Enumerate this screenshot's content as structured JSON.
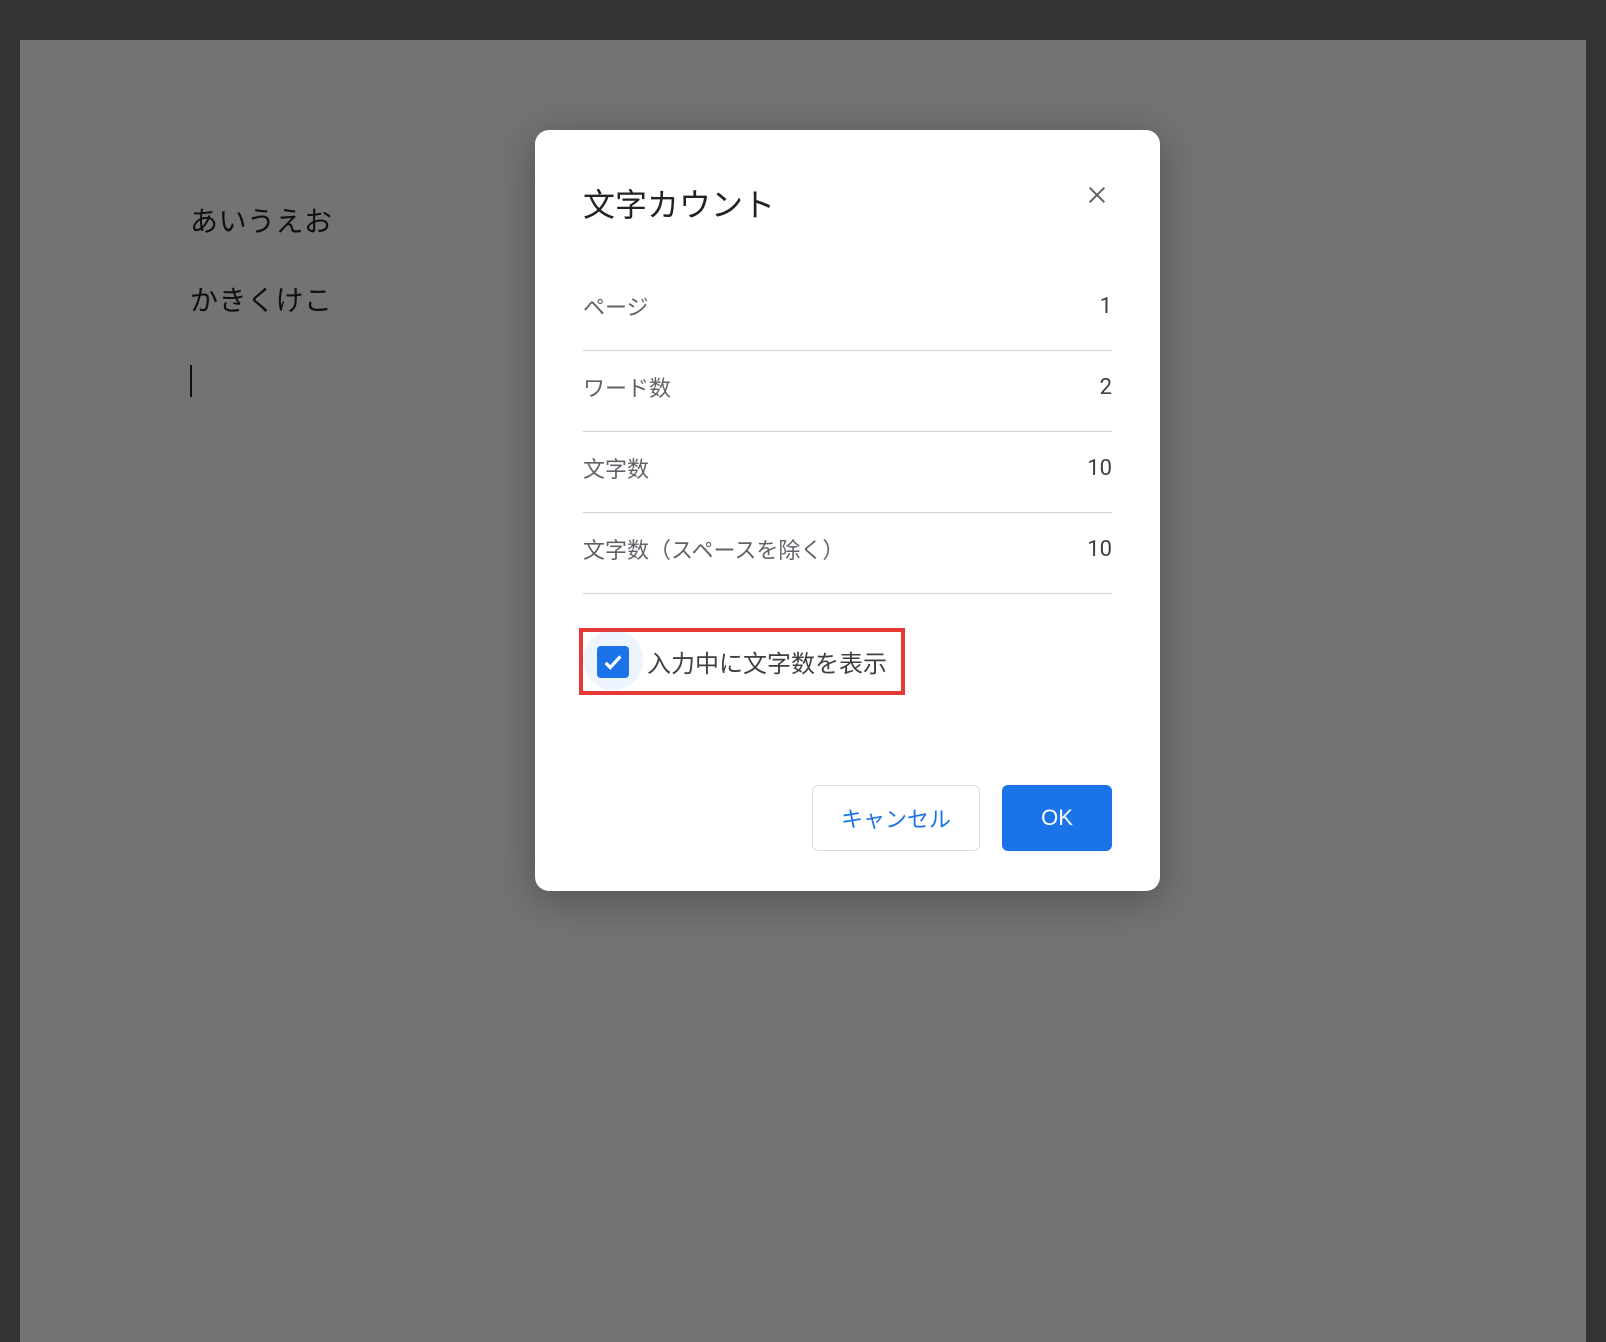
{
  "document": {
    "line1": "あいうえお",
    "line2": "かきくけこ"
  },
  "dialog": {
    "title": "文字カウント",
    "stats": [
      {
        "label": "ページ",
        "value": "1"
      },
      {
        "label": "ワード数",
        "value": "2"
      },
      {
        "label": "文字数",
        "value": "10"
      },
      {
        "label": "文字数（スペースを除く）",
        "value": "10"
      }
    ],
    "checkbox": {
      "label": "入力中に文字数を表示",
      "checked": true
    },
    "actions": {
      "cancel": "キャンセル",
      "ok": "OK"
    }
  }
}
